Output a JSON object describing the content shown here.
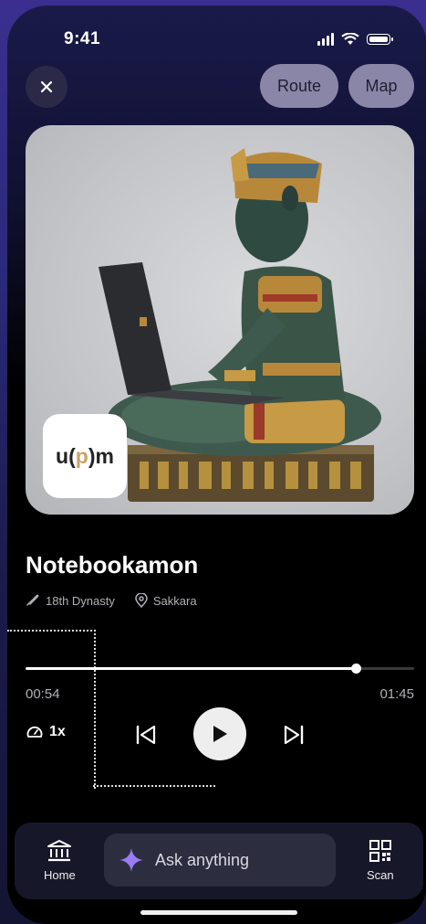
{
  "status_bar": {
    "time": "9:41"
  },
  "header": {
    "route_label": "Route",
    "map_label": "Map"
  },
  "artwork": {
    "logo_prefix": "u(",
    "logo_mid": "p",
    "logo_suffix": ")m"
  },
  "exhibit": {
    "title": "Notebookamon",
    "dynasty": "18th Dynasty",
    "location": "Sakkara"
  },
  "player": {
    "progress": 0.85,
    "elapsed": "00:54",
    "total": "01:45",
    "speed": "1x"
  },
  "bottom_nav": {
    "home_label": "Home",
    "ask_placeholder": "Ask anything",
    "scan_label": "Scan"
  },
  "colors": {
    "accent": "#9b7bf2",
    "pill_bg": "#8a86a8"
  }
}
